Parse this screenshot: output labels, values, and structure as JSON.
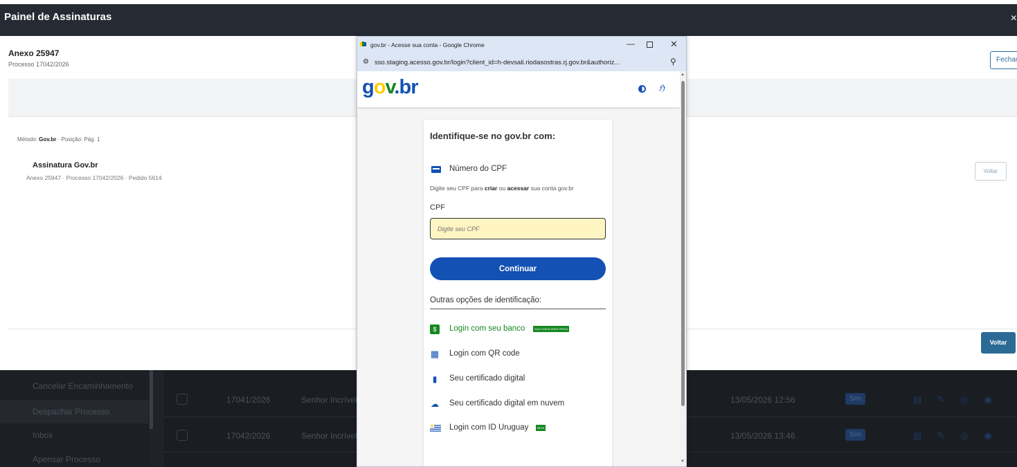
{
  "header": {
    "title": "Painel de Assinaturas",
    "close": "×"
  },
  "panel": {
    "anexo_title": "Anexo 25947",
    "anexo_sub": "Processo 17042/2026",
    "fechar_label": "Fechar",
    "metodo_prefix": "Método: ",
    "metodo_value": "Gov.br",
    "metodo_suffix": " · Posição: Pág. 1",
    "assinatura_title": "Assinatura Gov.br",
    "assinatura_sub": "Anexo 25947 · Processo 17042/2026 · Pedido 5614",
    "voltar_outline": "Voltar",
    "voltar_solid": "Voltar"
  },
  "background": {
    "sidebar_items": [
      "Cancelar Encaminhamento",
      "Despachar Processo",
      "Inbox",
      "Apensar Processo"
    ],
    "rows": [
      {
        "processo": "17041/2026",
        "interessado": "Senhor Incrível",
        "data": "13/05/2026 12:56",
        "badge": "Sim"
      },
      {
        "processo": "17042/2026",
        "interessado": "Senhor Incrível",
        "data": "13/05/2026 13:46",
        "badge": "Sim"
      }
    ]
  },
  "chrome": {
    "window_title": "gov.br - Acesse sua conta - Google Chrome",
    "url": "sso.staging.acesso.gov.br/login?client_id=h-devsali.riodasostras.rj.gov.br&authoriz...",
    "minimize": "—",
    "close": "✕"
  },
  "govbr": {
    "logo_g": "g",
    "logo_o": "o",
    "logo_v": "v",
    "logo_dot": ".",
    "logo_br": "br",
    "card_title": "Identifique-se no gov.br com:",
    "cpf_option": "Número do CPF",
    "cpf_help_1": "Digite seu CPF para ",
    "cpf_help_criar": "criar",
    "cpf_help_2": " ou ",
    "cpf_help_acessar": "acessar",
    "cpf_help_3": " sua conta gov.br",
    "cpf_label": "CPF",
    "cpf_placeholder": "Digite seu CPF",
    "continuar": "Continuar",
    "outras": "Outras opções de identificação:",
    "options": [
      {
        "label": "Login com seu banco",
        "badge": "SUA CONTA SERÁ PRATA",
        "icon": "bank-icon"
      },
      {
        "label": "Login com QR code",
        "icon": "qr-code-icon"
      },
      {
        "label": "Seu certificado digital",
        "icon": "usb-token-icon"
      },
      {
        "label": "Seu certificado digital em nuvem",
        "icon": "cloud-icon"
      },
      {
        "label": "Login com ID Uruguay",
        "badge": "BETA",
        "icon": "uruguay-flag-icon"
      }
    ]
  },
  "colors": {
    "govbr_blue": "#1351b4",
    "govbr_green": "#168821",
    "govbr_yellow": "#ffcd07",
    "header_dark": "#262b33",
    "primary_button": "#2c6a96"
  }
}
